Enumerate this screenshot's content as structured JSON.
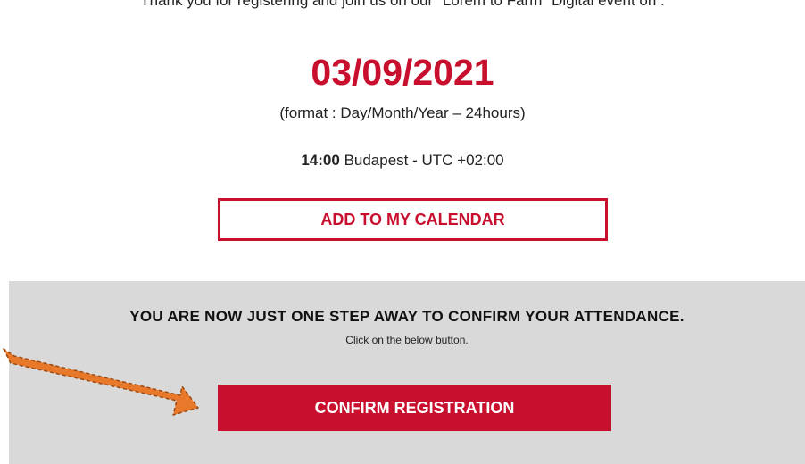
{
  "intro": {
    "cut_text": "Thank you for registering and join us on our \"Lorem to Farm\" Digital event on :"
  },
  "event": {
    "date": "03/09/2021",
    "format_note": "(format : Day/Month/Year – 24hours)",
    "time": "14:00",
    "timezone": "Budapest - UTC +02:00"
  },
  "calendar": {
    "button_label": "ADD TO MY CALENDAR"
  },
  "confirm": {
    "heading": "YOU ARE NOW JUST ONE STEP AWAY TO CONFIRM YOUR ATTENDANCE.",
    "note": "Click on the below button.",
    "button_label": "CONFIRM REGISTRATION"
  },
  "colors": {
    "accent": "#c8102e",
    "panel_bg": "#d9d9d9",
    "arrow": "#e8792b"
  },
  "icons": {
    "pointer": "arrow-pointer-icon"
  }
}
